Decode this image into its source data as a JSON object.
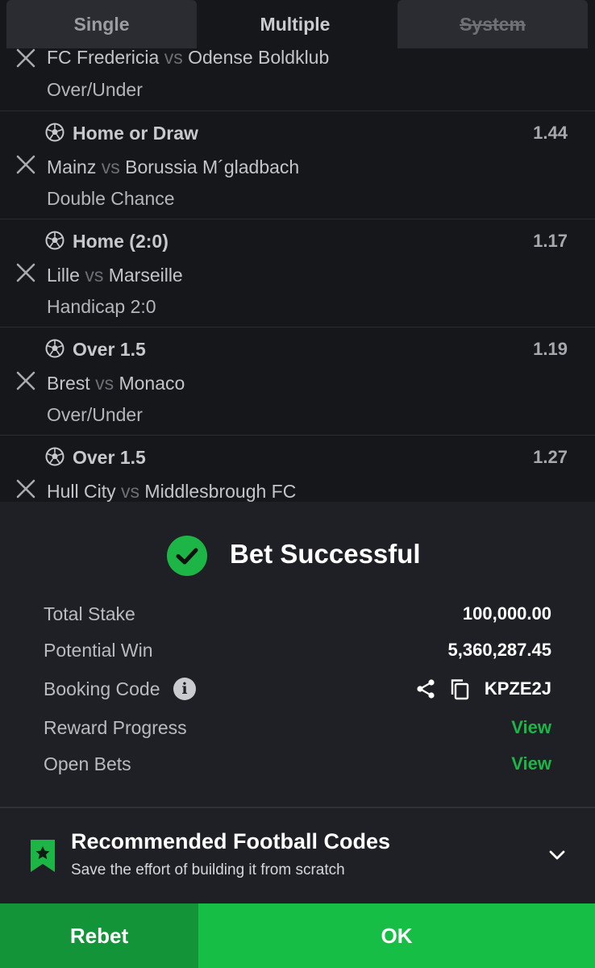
{
  "tabs": {
    "single": "Single",
    "multiple": "Multiple",
    "system": "System"
  },
  "bets": [
    {
      "pick": "",
      "odds": "",
      "home": "FC Fredericia",
      "vs": "vs",
      "away": "Odense Boldklub",
      "market": "Over/Under"
    },
    {
      "pick": "Home or Draw",
      "odds": "1.44",
      "home": "Mainz",
      "vs": "vs",
      "away": "Borussia M´gladbach",
      "market": "Double Chance"
    },
    {
      "pick": "Home (2:0)",
      "odds": "1.17",
      "home": "Lille",
      "vs": "vs",
      "away": "Marseille",
      "market": "Handicap 2:0"
    },
    {
      "pick": "Over 1.5",
      "odds": "1.19",
      "home": "Brest",
      "vs": "vs",
      "away": "Monaco",
      "market": "Over/Under"
    },
    {
      "pick": "Over 1.5",
      "odds": "1.27",
      "home": "Hull City",
      "vs": "vs",
      "away": "Middlesbrough FC",
      "market": ""
    }
  ],
  "result": {
    "title": "Bet Successful",
    "total_stake_label": "Total Stake",
    "total_stake": "100,000.00",
    "potential_win_label": "Potential Win",
    "potential_win": "5,360,287.45",
    "booking_code_label": "Booking Code",
    "booking_code": "KPZE2J",
    "info_glyph": "i",
    "reward_progress_label": "Reward Progress",
    "reward_progress_link": "View",
    "open_bets_label": "Open Bets",
    "open_bets_link": "View"
  },
  "recommended": {
    "title": "Recommended Football Codes",
    "subtitle": "Save the effort of building it from scratch"
  },
  "buttons": {
    "rebet": "Rebet",
    "ok": "OK"
  },
  "colors": {
    "accent_green": "#1db545",
    "button_green": "#17be46",
    "rebet_green": "#139438",
    "panel": "#1e2026",
    "background": "#16171b"
  }
}
